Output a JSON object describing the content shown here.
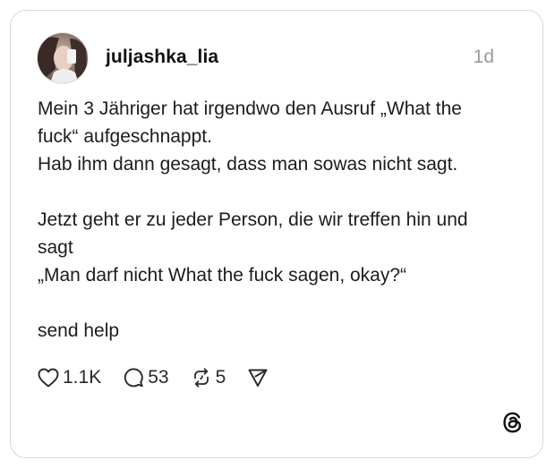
{
  "post": {
    "username": "juljashka_lia",
    "time": "1d",
    "lines": [
      "Mein 3 Jähriger hat irgendwo den Ausruf „What the",
      "fuck“ aufgeschnappt.",
      "Hab ihm dann gesagt, dass man sowas nicht sagt.",
      "",
      "Jetzt geht er zu jeder Person, die wir treffen hin und",
      "sagt",
      "„Man darf nicht What the fuck sagen, okay?“",
      "",
      "send help"
    ]
  },
  "actions": {
    "likes": "1.1K",
    "comments": "53",
    "reposts": "5"
  },
  "icons": {
    "like": "heart-icon",
    "comment": "comment-bubble-icon",
    "repost": "repost-icon",
    "share": "send-icon",
    "brand": "threads-logo-icon"
  }
}
